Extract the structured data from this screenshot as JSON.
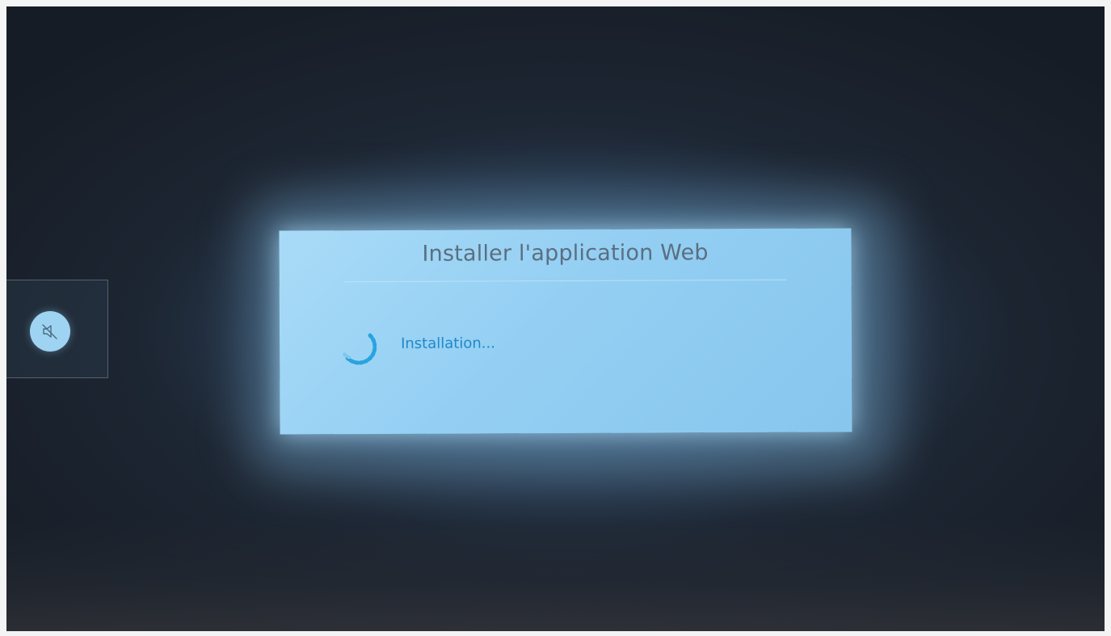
{
  "dialog": {
    "title": "Installer l'application Web",
    "status": "Installation..."
  },
  "side_panel": {
    "icon": "volume-mute-icon"
  },
  "colors": {
    "dialog_background": "#94cff3",
    "title_text": "#5a6f80",
    "status_text": "#1f88c9",
    "spinner": "#2aa3e0",
    "mute_button": "#9fd3f2"
  }
}
